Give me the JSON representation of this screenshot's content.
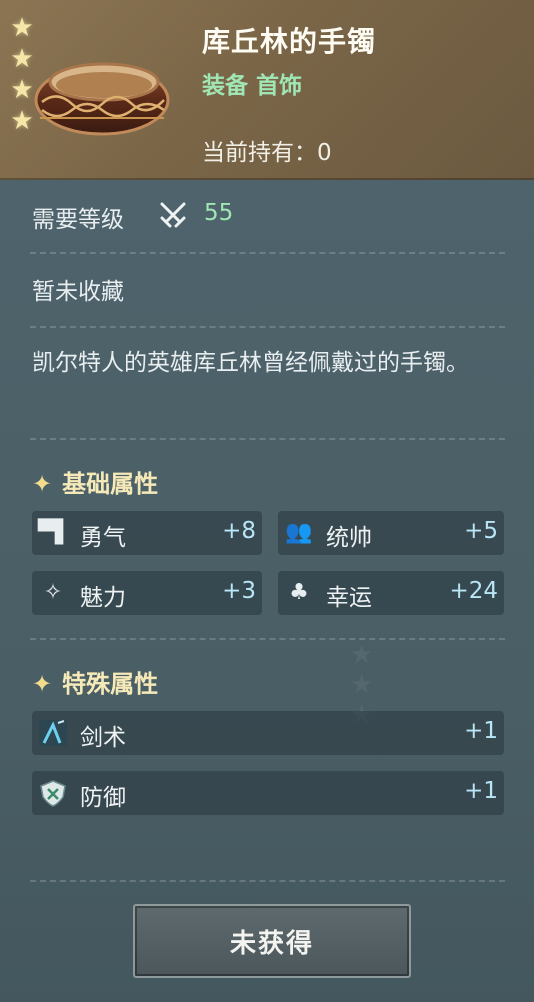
{
  "item": {
    "name": "库丘林的手镯",
    "type": "装备 首饰",
    "held_label": "当前持有：",
    "held_count": "0",
    "star_count": 4
  },
  "requirement": {
    "label": "需要等级",
    "level": "55",
    "icon": "crossed-swords-icon"
  },
  "collection_status": "暂未收藏",
  "description": "凯尔特人的英雄库丘林曾经佩戴过的手镯。",
  "basic_attrs": {
    "title": "基础属性",
    "items": [
      {
        "icon": "bar-chart-icon",
        "name": "勇气",
        "value": "+8"
      },
      {
        "icon": "group-icon",
        "name": "统帅",
        "value": "+5"
      },
      {
        "icon": "sparkle-icon",
        "name": "魅力",
        "value": "+3"
      },
      {
        "icon": "clover-icon",
        "name": "幸运",
        "value": "+24"
      }
    ]
  },
  "special_attrs": {
    "title": "特殊属性",
    "items": [
      {
        "icon": "swordsman-icon",
        "name": "剑术",
        "value": "+1"
      },
      {
        "icon": "shield-sword-icon",
        "name": "防御",
        "value": "+1"
      }
    ]
  },
  "action_button": "未获得",
  "colors": {
    "header_bg": "#7a6547",
    "panel_bg": "#4d6169",
    "item_type": "#9fe6b4",
    "level_value": "#9fe6b4",
    "stat_value": "#b9e6f7",
    "section_title": "#f6e9b8"
  }
}
